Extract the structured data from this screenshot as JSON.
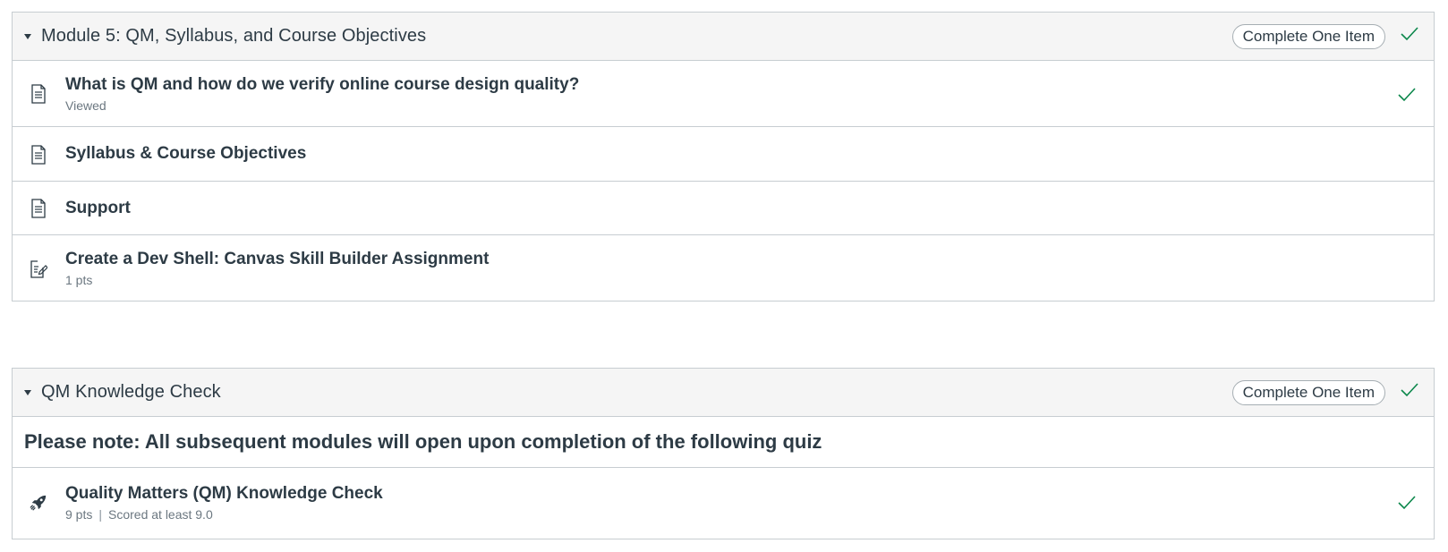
{
  "colors": {
    "check_green": "#0b874b",
    "header_bg": "#f5f5f5",
    "border": "#c7cdd1",
    "text": "#2d3b45",
    "meta_text": "#6b7780"
  },
  "modules": [
    {
      "title": "Module 5: QM, Syllabus, and Course Objectives",
      "requirement": "Complete One Item",
      "completed": true,
      "items": [
        {
          "icon": "page-icon",
          "title": "What is QM and how do we verify online course design quality?",
          "meta": "Viewed",
          "completed": true
        },
        {
          "icon": "page-icon",
          "title": "Syllabus & Course Objectives",
          "meta": "",
          "completed": false
        },
        {
          "icon": "page-icon",
          "title": "Support",
          "meta": "",
          "completed": false
        },
        {
          "icon": "assignment-icon",
          "title": "Create a Dev Shell: Canvas Skill Builder Assignment",
          "meta": "1 pts",
          "completed": false
        }
      ]
    },
    {
      "title": "QM Knowledge Check",
      "requirement": "Complete One Item",
      "completed": true,
      "subheader": "Please note: All subsequent modules will open upon completion of the following quiz",
      "items": [
        {
          "icon": "quiz-rocket-icon",
          "title": "Quality Matters (QM) Knowledge Check",
          "points": "9 pts",
          "separator": "|",
          "requirement_met": "Scored at least 9.0",
          "completed": true
        }
      ]
    }
  ]
}
